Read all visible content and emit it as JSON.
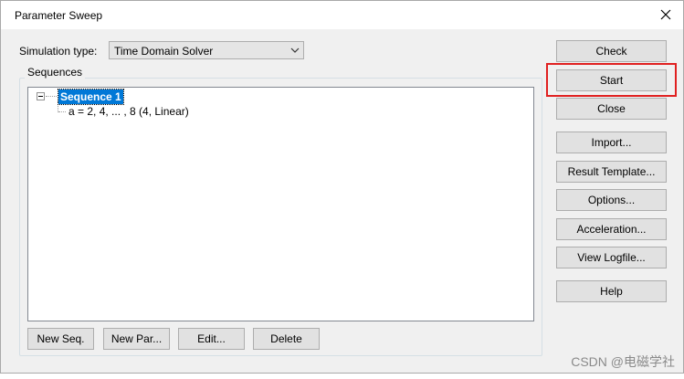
{
  "window": {
    "title": "Parameter Sweep",
    "close_icon": "close-icon"
  },
  "simulation": {
    "label": "Simulation type:",
    "selected": "Time Domain Solver"
  },
  "sequences": {
    "caption": "Sequences",
    "tree": [
      {
        "label": "Sequence 1",
        "selected": true,
        "expanded": true,
        "children": [
          {
            "label": "a = 2, 4, ... , 8 (4, Linear)"
          }
        ]
      }
    ]
  },
  "bottom_buttons": {
    "new_seq": "New Seq.",
    "new_par": "New Par...",
    "edit": "Edit...",
    "delete": "Delete"
  },
  "side_buttons": {
    "check": "Check",
    "start": "Start",
    "close": "Close",
    "import": "Import...",
    "result_template": "Result Template...",
    "options": "Options...",
    "acceleration": "Acceleration...",
    "view_logfile": "View Logfile...",
    "help": "Help"
  },
  "annotation": {
    "highlight_color": "#e02020"
  },
  "watermark": "CSDN @电磁学社"
}
